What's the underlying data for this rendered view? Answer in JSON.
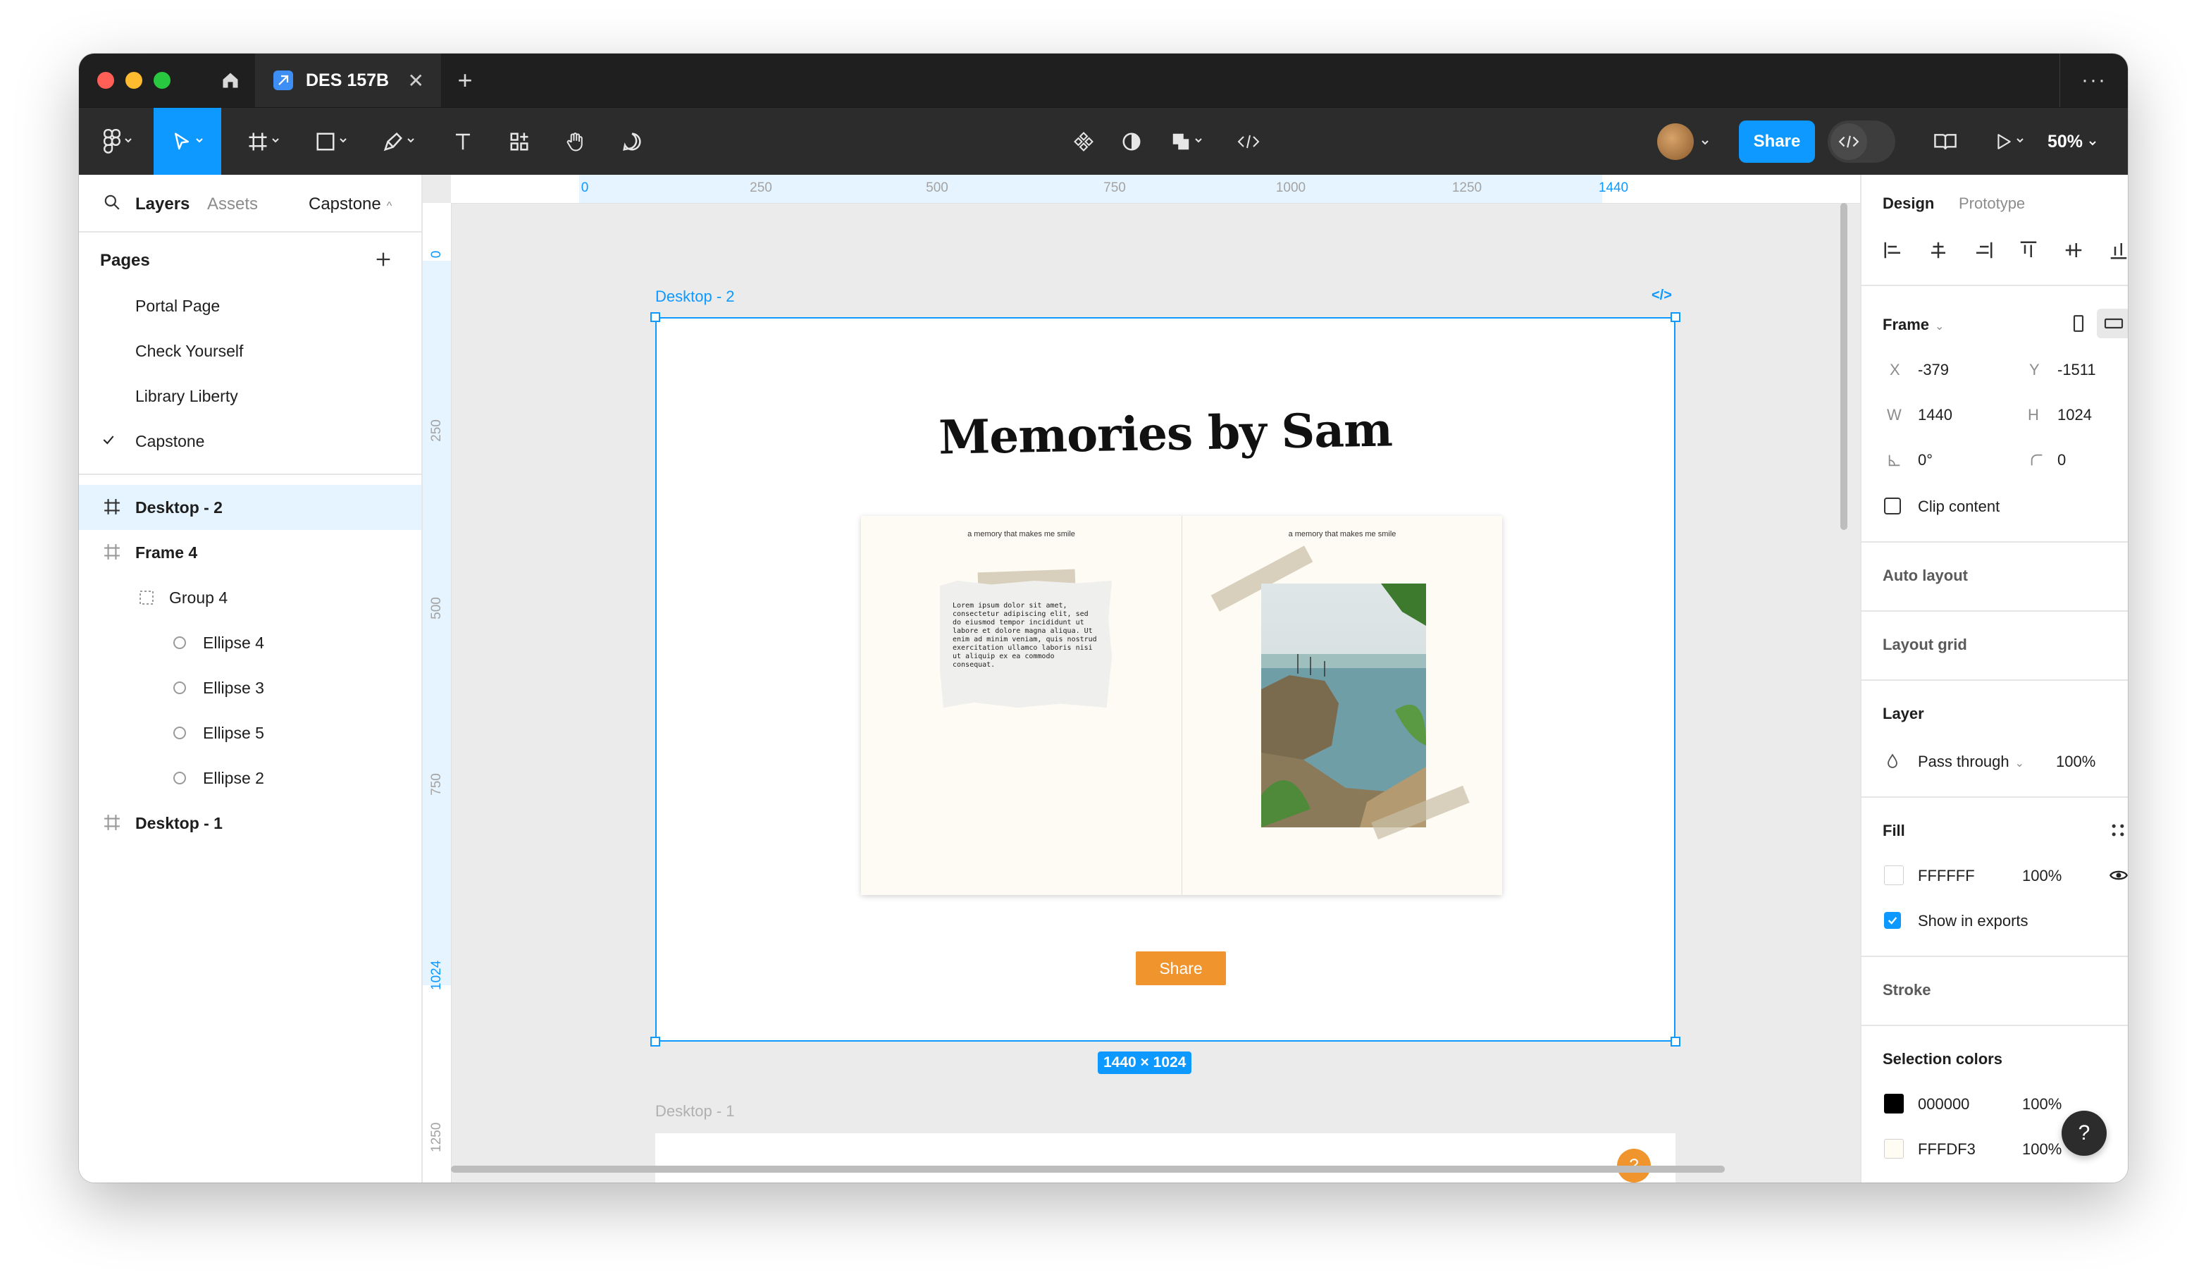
{
  "window": {
    "tab_title": "DES 157B",
    "new_tab": "+",
    "more": "···"
  },
  "toolbar": {
    "share_label": "Share",
    "zoom": "50%"
  },
  "left_panel": {
    "tabs": {
      "layers": "Layers",
      "assets": "Assets",
      "page_select": "Capstone"
    },
    "pages_header": "Pages",
    "pages": [
      {
        "label": "Portal Page",
        "current": false
      },
      {
        "label": "Check Yourself",
        "current": false
      },
      {
        "label": "Library Liberty",
        "current": false
      },
      {
        "label": "Capstone",
        "current": true
      }
    ],
    "layers": [
      {
        "label": "Desktop - 2",
        "icon": "frame-icon",
        "selected": true
      },
      {
        "label": "Frame 4",
        "icon": "frame-icon",
        "selected": false
      },
      {
        "label": "Group 4",
        "icon": "group-icon",
        "selected": false
      },
      {
        "label": "Ellipse 4",
        "icon": "ellipse-icon",
        "selected": false
      },
      {
        "label": "Ellipse 3",
        "icon": "ellipse-icon",
        "selected": false
      },
      {
        "label": "Ellipse 5",
        "icon": "ellipse-icon",
        "selected": false
      },
      {
        "label": "Ellipse 2",
        "icon": "ellipse-icon",
        "selected": false
      },
      {
        "label": "Desktop - 1",
        "icon": "frame-icon",
        "selected": false
      }
    ]
  },
  "canvas": {
    "ruler_top": [
      "0",
      "250",
      "500",
      "750",
      "1000",
      "1250",
      "1440"
    ],
    "ruler_left": [
      "0",
      "250",
      "500",
      "750",
      "1024",
      "1250"
    ],
    "frame_label": "Desktop - 2",
    "frame_code_icon": "</>",
    "title": "Memories by Sam",
    "caption_left": "a memory that makes me smile",
    "caption_right": "a memory that makes me smile",
    "note_text": "Lorem ipsum dolor sit amet, consectetur adipiscing elit, sed do eiusmod tempor incididunt ut labore et dolore magna aliqua. Ut enim ad minim veniam, quis nostrud exercitation ullamco laboris nisi ut aliquip ex ea commodo consequat.",
    "share_button": "Share",
    "dimensions": "1440 × 1024",
    "frame2_label": "Desktop - 1",
    "help_orange": "?"
  },
  "right_panel": {
    "tabs": {
      "design": "Design",
      "prototype": "Prototype"
    },
    "frame_header": "Frame",
    "x_label": "X",
    "x_value": "-379",
    "y_label": "Y",
    "y_value": "-1511",
    "w_label": "W",
    "w_value": "1440",
    "h_label": "H",
    "h_value": "1024",
    "rotation": "0°",
    "radius": "0",
    "clip_content": "Clip content",
    "auto_layout": "Auto layout",
    "layout_grid": "Layout grid",
    "layer_header": "Layer",
    "blend_mode": "Pass through",
    "layer_opacity": "100%",
    "fill_header": "Fill",
    "fill": {
      "hex": "FFFFFF",
      "opacity": "100%"
    },
    "show_in_exports": "Show in exports",
    "stroke_header": "Stroke",
    "selection_colors_header": "Selection colors",
    "selection_colors": [
      {
        "hex": "000000",
        "opacity": "100%",
        "color": "#000000"
      },
      {
        "hex": "FFFDF3",
        "opacity": "100%",
        "color": "#FFFDF3"
      }
    ]
  },
  "help_dark": "?",
  "colors": {
    "accent": "#0d99ff",
    "orange": "#f0952e"
  }
}
